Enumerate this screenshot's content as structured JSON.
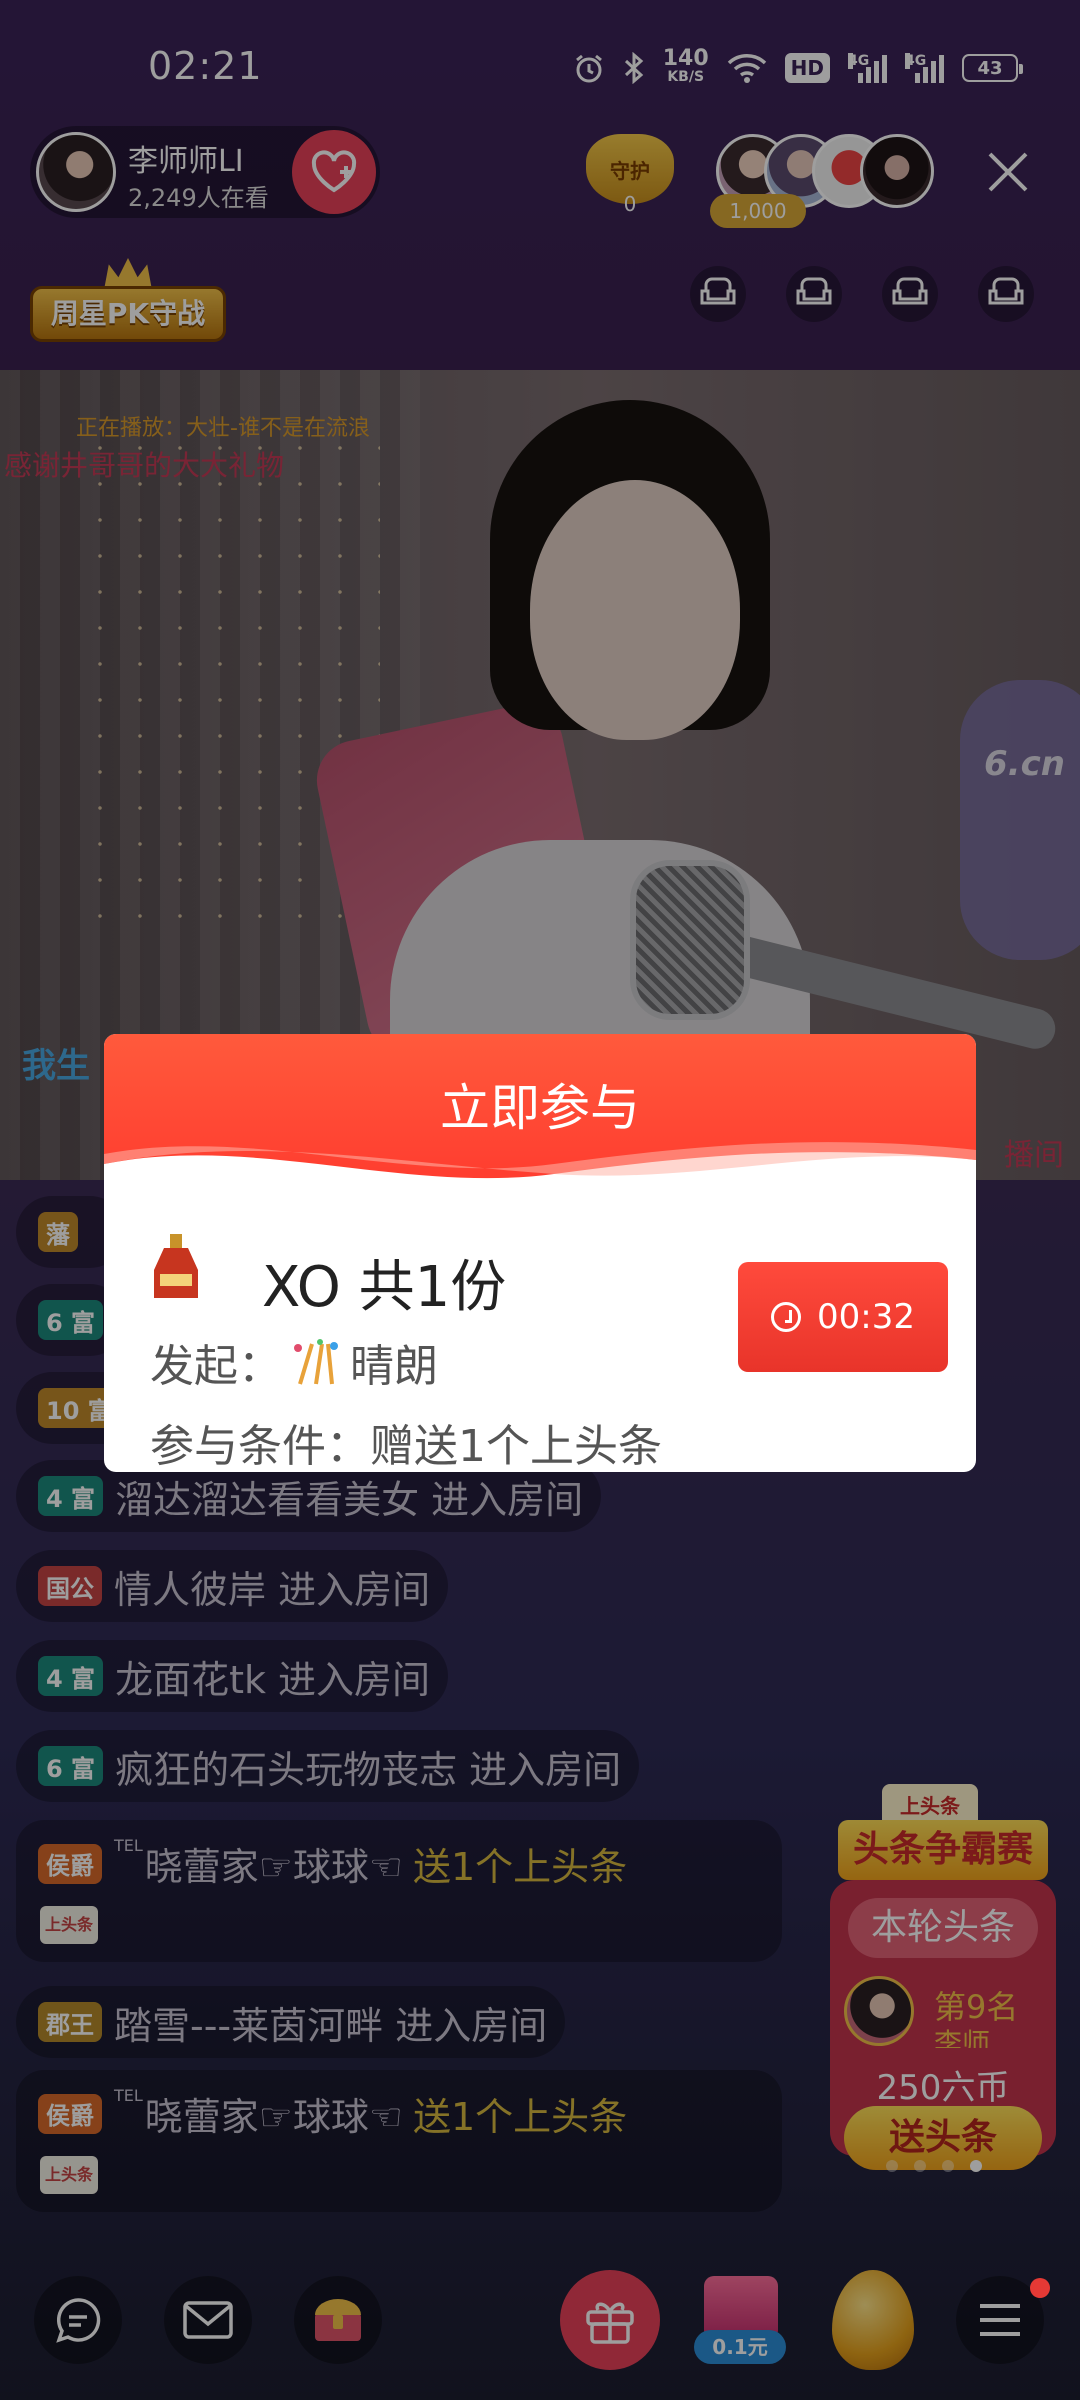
{
  "status_bar": {
    "time": "02:21",
    "net_speed_value": "140",
    "net_speed_unit": "KB/S",
    "hd": "HD",
    "signal1": "4G",
    "signal2": "4G",
    "battery": "43"
  },
  "header": {
    "host_name": "李师师LI",
    "viewer_count": "2,249人在看",
    "guard_label": "守护",
    "guard_count": "0",
    "fans_value": "1,000",
    "event_badge": "周星PK守战"
  },
  "video_overlay": {
    "now_playing": "正在播放：大壮-谁不是在流浪",
    "thanks": "感谢井哥哥的大大礼物",
    "watermark": "6.cn",
    "left_caption": "我生",
    "right_caption": "播间"
  },
  "modal": {
    "title": "立即参与",
    "prize": "XO 共1份",
    "initiator_label": "发起：",
    "initiator_name": "晴朗",
    "condition": "参与条件：赠送1个上头条",
    "timer": "00:32"
  },
  "chat": {
    "rows": [
      {
        "badge": "6 富",
        "text": "溜达溜达看看美女 进入房间"
      },
      {
        "badge": "4 富",
        "text": "溜达溜达看看美女 进入房间"
      },
      {
        "badge": "国公",
        "text": "情人彼岸 进入房间"
      },
      {
        "badge": "4 富",
        "text": "龙面花tk 进入房间"
      },
      {
        "badge": "6 富",
        "text": "疯狂的石头玩物丧志 进入房间"
      },
      {
        "badge": "郡王",
        "text": "踏雪---莱茵河畔 进入房间"
      }
    ],
    "gift_msgs": [
      {
        "badge": "侯爵",
        "sup": "TEL",
        "user": "晓蕾家☞球球☜",
        "action": "送1个上头条",
        "tag": "上头条"
      },
      {
        "badge": "侯爵",
        "sup": "TEL",
        "user": "晓蕾家☞球球☜",
        "action": "送1个上头条",
        "tag": "上头条"
      }
    ],
    "partial_badges": [
      "藩",
      "6 富",
      "10 富"
    ]
  },
  "promo": {
    "tab": "上头条",
    "title": "头条争霸赛",
    "round": "本轮头条",
    "rank": "第9名",
    "name": "李师",
    "coins": "250六币",
    "button": "送头条"
  },
  "bottom_bar": {
    "pack_price": "0.1元"
  },
  "colors": {
    "accent_red": "#ff3a2e",
    "follow_pink": "#e8415a",
    "gold": "#d7b940"
  }
}
